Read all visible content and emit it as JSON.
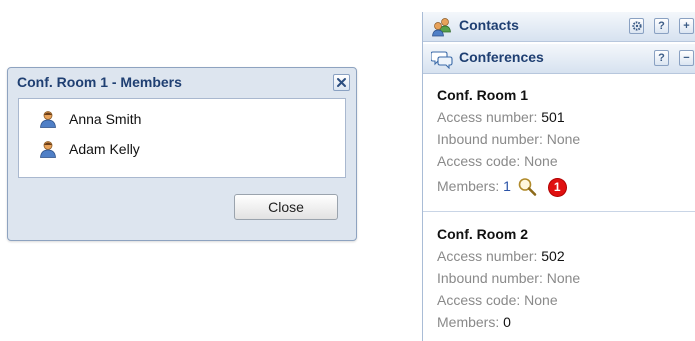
{
  "dialog": {
    "title": "Conf. Room 1 - Members",
    "members": [
      {
        "name": "Anna Smith"
      },
      {
        "name": "Adam Kelly"
      }
    ],
    "close_label": "Close"
  },
  "panel": {
    "contacts_header": "Contacts",
    "conferences_header": "Conferences",
    "buttons": {
      "help": "?",
      "add": "+",
      "collapse": "−"
    },
    "rooms": [
      {
        "name": "Conf. Room 1",
        "access_number_label": "Access number:",
        "access_number": "501",
        "inbound_label": "Inbound number: None",
        "access_code_label": "Access code: None",
        "members_label": "Members:",
        "members": "1",
        "badge": "1"
      },
      {
        "name": "Conf. Room 2",
        "access_number_label": "Access number:",
        "access_number": "502",
        "inbound_label": "Inbound number: None",
        "access_code_label": "Access code: None",
        "members_label": "Members:",
        "members": "0"
      }
    ]
  },
  "colors": {
    "title_blue": "#1f3f72",
    "link_blue": "#2b53a7",
    "badge_red": "#e01010"
  }
}
